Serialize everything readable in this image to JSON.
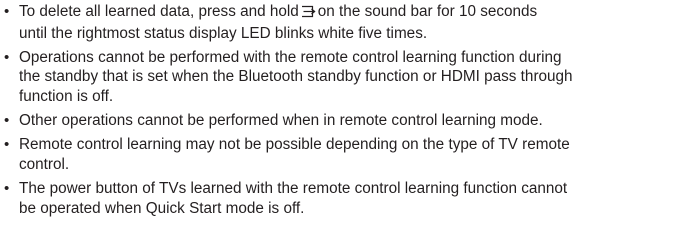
{
  "notes": [
    {
      "lines": [
        {
          "before": "To delete all learned data, press and hold",
          "icon": "input-icon",
          "after": "on the sound bar for 10 seconds"
        },
        {
          "text": "until the rightmost status display LED blinks white five times."
        }
      ]
    },
    {
      "lines": [
        {
          "text": "Operations cannot be performed with the remote control learning function during"
        },
        {
          "text": "the standby that is set when the Bluetooth standby function or HDMI pass through"
        },
        {
          "text": "function is off."
        }
      ]
    },
    {
      "lines": [
        {
          "text": "Other operations cannot be performed when in remote control learning mode."
        }
      ]
    },
    {
      "lines": [
        {
          "text": "Remote control learning may not be possible depending on the type of TV remote"
        },
        {
          "text": "control."
        }
      ]
    },
    {
      "lines": [
        {
          "text": "The power button of TVs learned with the remote control learning function cannot"
        },
        {
          "text": "be operated when Quick Start mode is off."
        }
      ]
    }
  ],
  "bullet_glyph": "•"
}
